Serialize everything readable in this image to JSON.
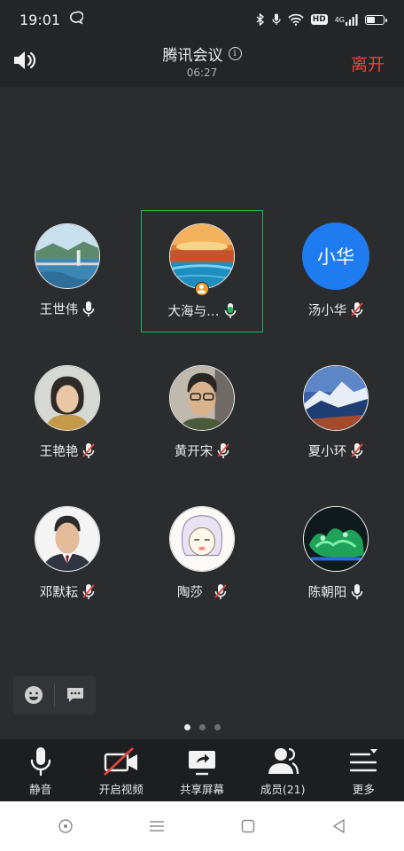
{
  "status_bar": {
    "time": "19:01",
    "network_label": "4G"
  },
  "header": {
    "title": "腾讯会议",
    "duration": "06:27",
    "leave_label": "离开"
  },
  "participants": [
    {
      "name": "王世伟",
      "mic": "on",
      "avatar": "bridge-photo"
    },
    {
      "name": "大海与…",
      "mic": "speaking",
      "avatar": "sunset-sea-photo",
      "host": true,
      "active": true
    },
    {
      "name": "汤小华",
      "mic": "muted",
      "avatar_text": "小华"
    },
    {
      "name": "王艳艳",
      "mic": "muted",
      "avatar": "person-photo"
    },
    {
      "name": "黄开宋",
      "mic": "muted",
      "avatar": "person-glasses-photo"
    },
    {
      "name": "夏小环",
      "mic": "muted",
      "avatar": "snow-mountain-photo"
    },
    {
      "name": "邓默耘",
      "mic": "muted",
      "avatar": "man-suit-photo"
    },
    {
      "name": "陶莎",
      "mic": "muted",
      "avatar": "cartoon-girl-drawing"
    },
    {
      "name": "陈朝阳",
      "mic": "on",
      "avatar": "green-lights-photo"
    }
  ],
  "pager": {
    "current": 1,
    "total": 3
  },
  "toolbar": {
    "mute_label": "静音",
    "video_label": "开启视频",
    "share_label": "共享屏幕",
    "members_label": "成员(21)",
    "more_label": "更多"
  },
  "colors": {
    "leave_red": "#f0443a",
    "active_green": "#19b85a",
    "avatar_blue": "#1f7bf0",
    "muted_red": "#e8453c"
  }
}
